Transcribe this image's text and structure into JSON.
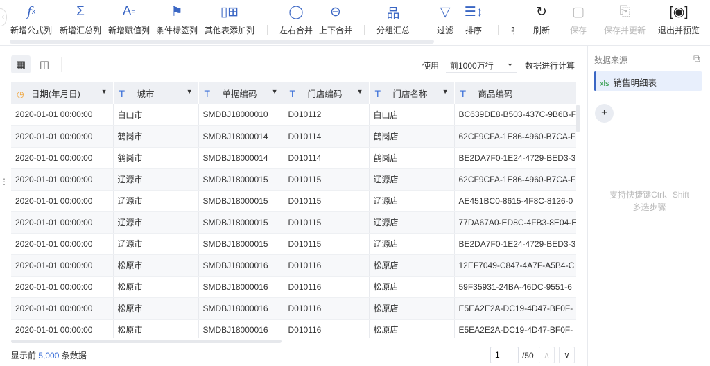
{
  "toolbar": {
    "items": [
      {
        "label": "新增公式列",
        "icon": "fx-icon"
      },
      {
        "label": "新增汇总列",
        "icon": "sigma-icon"
      },
      {
        "label": "新增赋值列",
        "icon": "assign-icon"
      },
      {
        "label": "条件标签列",
        "icon": "flag-icon"
      },
      {
        "label": "其他表添加列",
        "icon": "add-column-icon"
      },
      {
        "label": "左右合并",
        "icon": "merge-lr-icon"
      },
      {
        "label": "上下合并",
        "icon": "merge-ud-icon"
      },
      {
        "label": "分组汇总",
        "icon": "group-icon"
      },
      {
        "label": "过滤",
        "icon": "filter-icon"
      },
      {
        "label": "排序",
        "icon": "sort-icon"
      },
      {
        "label": "字段",
        "icon": "field-icon"
      }
    ],
    "right": [
      {
        "label": "刷新",
        "icon": "refresh-icon",
        "enabled": true
      },
      {
        "label": "保存",
        "icon": "save-icon",
        "enabled": false
      },
      {
        "label": "保存并更新",
        "icon": "save-update-icon",
        "enabled": false
      },
      {
        "label": "退出并预览",
        "icon": "preview-icon",
        "enabled": true
      }
    ]
  },
  "options": {
    "use_label": "使用",
    "rows_select": "前1000万行",
    "compute_label": "数据进行计算"
  },
  "table": {
    "columns": [
      {
        "label": "日期(年月日)",
        "type": "date"
      },
      {
        "label": "城市",
        "type": "text"
      },
      {
        "label": "单据编码",
        "type": "text"
      },
      {
        "label": "门店编码",
        "type": "text"
      },
      {
        "label": "门店名称",
        "type": "text"
      },
      {
        "label": "商品编码",
        "type": "text"
      }
    ],
    "rows": [
      [
        "2020-01-01 00:00:00",
        "白山市",
        "SMDBJ18000010",
        "D010112",
        "白山店",
        "BC639DE8-B503-437C-9B6B-F"
      ],
      [
        "2020-01-01 00:00:00",
        "鹤岗市",
        "SMDBJ18000014",
        "D010114",
        "鹤岗店",
        "62CF9CFA-1E86-4960-B7CA-F"
      ],
      [
        "2020-01-01 00:00:00",
        "鹤岗市",
        "SMDBJ18000014",
        "D010114",
        "鹤岗店",
        "BE2DA7F0-1E24-4729-BED3-3"
      ],
      [
        "2020-01-01 00:00:00",
        "辽源市",
        "SMDBJ18000015",
        "D010115",
        "辽源店",
        "62CF9CFA-1E86-4960-B7CA-F"
      ],
      [
        "2020-01-01 00:00:00",
        "辽源市",
        "SMDBJ18000015",
        "D010115",
        "辽源店",
        "AE451BC0-8615-4F8C-8126-0"
      ],
      [
        "2020-01-01 00:00:00",
        "辽源市",
        "SMDBJ18000015",
        "D010115",
        "辽源店",
        "77DA67A0-ED8C-4FB3-8E04-E"
      ],
      [
        "2020-01-01 00:00:00",
        "辽源市",
        "SMDBJ18000015",
        "D010115",
        "辽源店",
        "BE2DA7F0-1E24-4729-BED3-3"
      ],
      [
        "2020-01-01 00:00:00",
        "松原市",
        "SMDBJ18000016",
        "D010116",
        "松原店",
        "12EF7049-C847-4A7F-A5B4-C"
      ],
      [
        "2020-01-01 00:00:00",
        "松原市",
        "SMDBJ18000016",
        "D010116",
        "松原店",
        "59F35931-24BA-46DC-9551-6"
      ],
      [
        "2020-01-01 00:00:00",
        "松原市",
        "SMDBJ18000016",
        "D010116",
        "松原店",
        "E5EA2E2A-DC19-4D47-BF0F-"
      ],
      [
        "2020-01-01 00:00:00",
        "松原市",
        "SMDBJ18000016",
        "D010116",
        "松原店",
        "E5EA2E2A-DC19-4D47-BF0F-"
      ]
    ]
  },
  "footer": {
    "prefix": "显示前",
    "count": "5,000",
    "suffix": "条数据",
    "page": "1",
    "total_pages": "/50"
  },
  "right_panel": {
    "title": "数据来源",
    "source_badge": "xls",
    "source_name": "销售明细表",
    "hint_line1": "支持快捷键Ctrl、Shift",
    "hint_line2": "多选步骤"
  },
  "colors": {
    "accent": "#3a66c4",
    "active_source_bg": "#e8effc",
    "xls_green": "#2e9a48"
  }
}
